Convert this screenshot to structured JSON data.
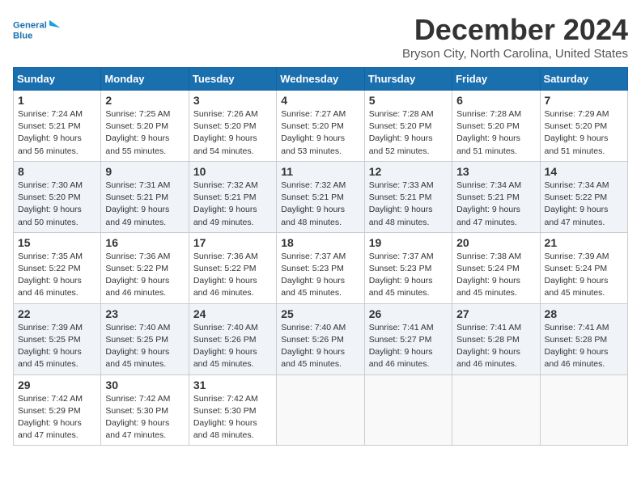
{
  "logo": {
    "line1": "General",
    "line2": "Blue"
  },
  "title": "December 2024",
  "subtitle": "Bryson City, North Carolina, United States",
  "weekdays": [
    "Sunday",
    "Monday",
    "Tuesday",
    "Wednesday",
    "Thursday",
    "Friday",
    "Saturday"
  ],
  "weeks": [
    [
      {
        "day": "1",
        "info": "Sunrise: 7:24 AM\nSunset: 5:21 PM\nDaylight: 9 hours\nand 56 minutes."
      },
      {
        "day": "2",
        "info": "Sunrise: 7:25 AM\nSunset: 5:20 PM\nDaylight: 9 hours\nand 55 minutes."
      },
      {
        "day": "3",
        "info": "Sunrise: 7:26 AM\nSunset: 5:20 PM\nDaylight: 9 hours\nand 54 minutes."
      },
      {
        "day": "4",
        "info": "Sunrise: 7:27 AM\nSunset: 5:20 PM\nDaylight: 9 hours\nand 53 minutes."
      },
      {
        "day": "5",
        "info": "Sunrise: 7:28 AM\nSunset: 5:20 PM\nDaylight: 9 hours\nand 52 minutes."
      },
      {
        "day": "6",
        "info": "Sunrise: 7:28 AM\nSunset: 5:20 PM\nDaylight: 9 hours\nand 51 minutes."
      },
      {
        "day": "7",
        "info": "Sunrise: 7:29 AM\nSunset: 5:20 PM\nDaylight: 9 hours\nand 51 minutes."
      }
    ],
    [
      {
        "day": "8",
        "info": "Sunrise: 7:30 AM\nSunset: 5:20 PM\nDaylight: 9 hours\nand 50 minutes."
      },
      {
        "day": "9",
        "info": "Sunrise: 7:31 AM\nSunset: 5:21 PM\nDaylight: 9 hours\nand 49 minutes."
      },
      {
        "day": "10",
        "info": "Sunrise: 7:32 AM\nSunset: 5:21 PM\nDaylight: 9 hours\nand 49 minutes."
      },
      {
        "day": "11",
        "info": "Sunrise: 7:32 AM\nSunset: 5:21 PM\nDaylight: 9 hours\nand 48 minutes."
      },
      {
        "day": "12",
        "info": "Sunrise: 7:33 AM\nSunset: 5:21 PM\nDaylight: 9 hours\nand 48 minutes."
      },
      {
        "day": "13",
        "info": "Sunrise: 7:34 AM\nSunset: 5:21 PM\nDaylight: 9 hours\nand 47 minutes."
      },
      {
        "day": "14",
        "info": "Sunrise: 7:34 AM\nSunset: 5:22 PM\nDaylight: 9 hours\nand 47 minutes."
      }
    ],
    [
      {
        "day": "15",
        "info": "Sunrise: 7:35 AM\nSunset: 5:22 PM\nDaylight: 9 hours\nand 46 minutes."
      },
      {
        "day": "16",
        "info": "Sunrise: 7:36 AM\nSunset: 5:22 PM\nDaylight: 9 hours\nand 46 minutes."
      },
      {
        "day": "17",
        "info": "Sunrise: 7:36 AM\nSunset: 5:22 PM\nDaylight: 9 hours\nand 46 minutes."
      },
      {
        "day": "18",
        "info": "Sunrise: 7:37 AM\nSunset: 5:23 PM\nDaylight: 9 hours\nand 45 minutes."
      },
      {
        "day": "19",
        "info": "Sunrise: 7:37 AM\nSunset: 5:23 PM\nDaylight: 9 hours\nand 45 minutes."
      },
      {
        "day": "20",
        "info": "Sunrise: 7:38 AM\nSunset: 5:24 PM\nDaylight: 9 hours\nand 45 minutes."
      },
      {
        "day": "21",
        "info": "Sunrise: 7:39 AM\nSunset: 5:24 PM\nDaylight: 9 hours\nand 45 minutes."
      }
    ],
    [
      {
        "day": "22",
        "info": "Sunrise: 7:39 AM\nSunset: 5:25 PM\nDaylight: 9 hours\nand 45 minutes."
      },
      {
        "day": "23",
        "info": "Sunrise: 7:40 AM\nSunset: 5:25 PM\nDaylight: 9 hours\nand 45 minutes."
      },
      {
        "day": "24",
        "info": "Sunrise: 7:40 AM\nSunset: 5:26 PM\nDaylight: 9 hours\nand 45 minutes."
      },
      {
        "day": "25",
        "info": "Sunrise: 7:40 AM\nSunset: 5:26 PM\nDaylight: 9 hours\nand 45 minutes."
      },
      {
        "day": "26",
        "info": "Sunrise: 7:41 AM\nSunset: 5:27 PM\nDaylight: 9 hours\nand 46 minutes."
      },
      {
        "day": "27",
        "info": "Sunrise: 7:41 AM\nSunset: 5:28 PM\nDaylight: 9 hours\nand 46 minutes."
      },
      {
        "day": "28",
        "info": "Sunrise: 7:41 AM\nSunset: 5:28 PM\nDaylight: 9 hours\nand 46 minutes."
      }
    ],
    [
      {
        "day": "29",
        "info": "Sunrise: 7:42 AM\nSunset: 5:29 PM\nDaylight: 9 hours\nand 47 minutes."
      },
      {
        "day": "30",
        "info": "Sunrise: 7:42 AM\nSunset: 5:30 PM\nDaylight: 9 hours\nand 47 minutes."
      },
      {
        "day": "31",
        "info": "Sunrise: 7:42 AM\nSunset: 5:30 PM\nDaylight: 9 hours\nand 48 minutes."
      },
      {
        "day": "",
        "info": ""
      },
      {
        "day": "",
        "info": ""
      },
      {
        "day": "",
        "info": ""
      },
      {
        "day": "",
        "info": ""
      }
    ]
  ]
}
